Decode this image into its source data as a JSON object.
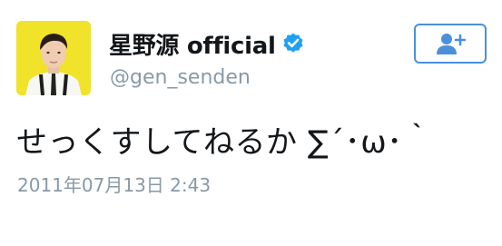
{
  "tweet": {
    "display_name": "星野源 official",
    "verified": true,
    "handle": "@gen_senden",
    "text": "せっくすしてねるか ∑´･ω･｀",
    "timestamp": "2011年07月13日 2:43"
  },
  "follow_button": {
    "icon": "add-user-icon"
  },
  "colors": {
    "name": "#14171a",
    "secondary": "#8899a6",
    "accent": "#4a90d9",
    "verified": "#1da1f2",
    "avatar_bg": "#f1e22a"
  }
}
